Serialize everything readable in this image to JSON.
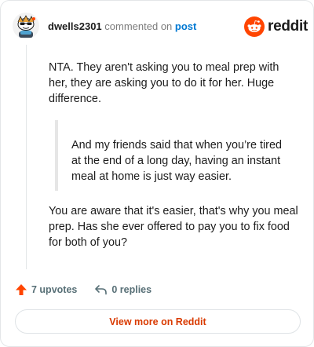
{
  "comment": {
    "username": "dwells2301",
    "action_text": "commented on",
    "post_link": "post",
    "paragraphs": [
      "NTA. They aren't asking you to meal prep with her, they are asking you to do it for her. Huge difference.",
      "You are aware that it's easier, that's why you meal prep. Has she ever offered to pay you to fix food for both of you?"
    ],
    "quote": "And my friends said that when you’re tired at the end of a long day, having an instant meal at home is just way easier."
  },
  "brand": {
    "wordmark": "reddit",
    "color": "#ff4500"
  },
  "stats": {
    "upvotes_label": "7 upvotes",
    "replies_label": "0 replies",
    "upvote_color": "#ff4500"
  },
  "view_more_label": "View more on Reddit",
  "icons": [
    "snoo-avatar-icon",
    "reddit-logo-icon",
    "upvote-arrow-icon",
    "reply-arrow-icon"
  ]
}
